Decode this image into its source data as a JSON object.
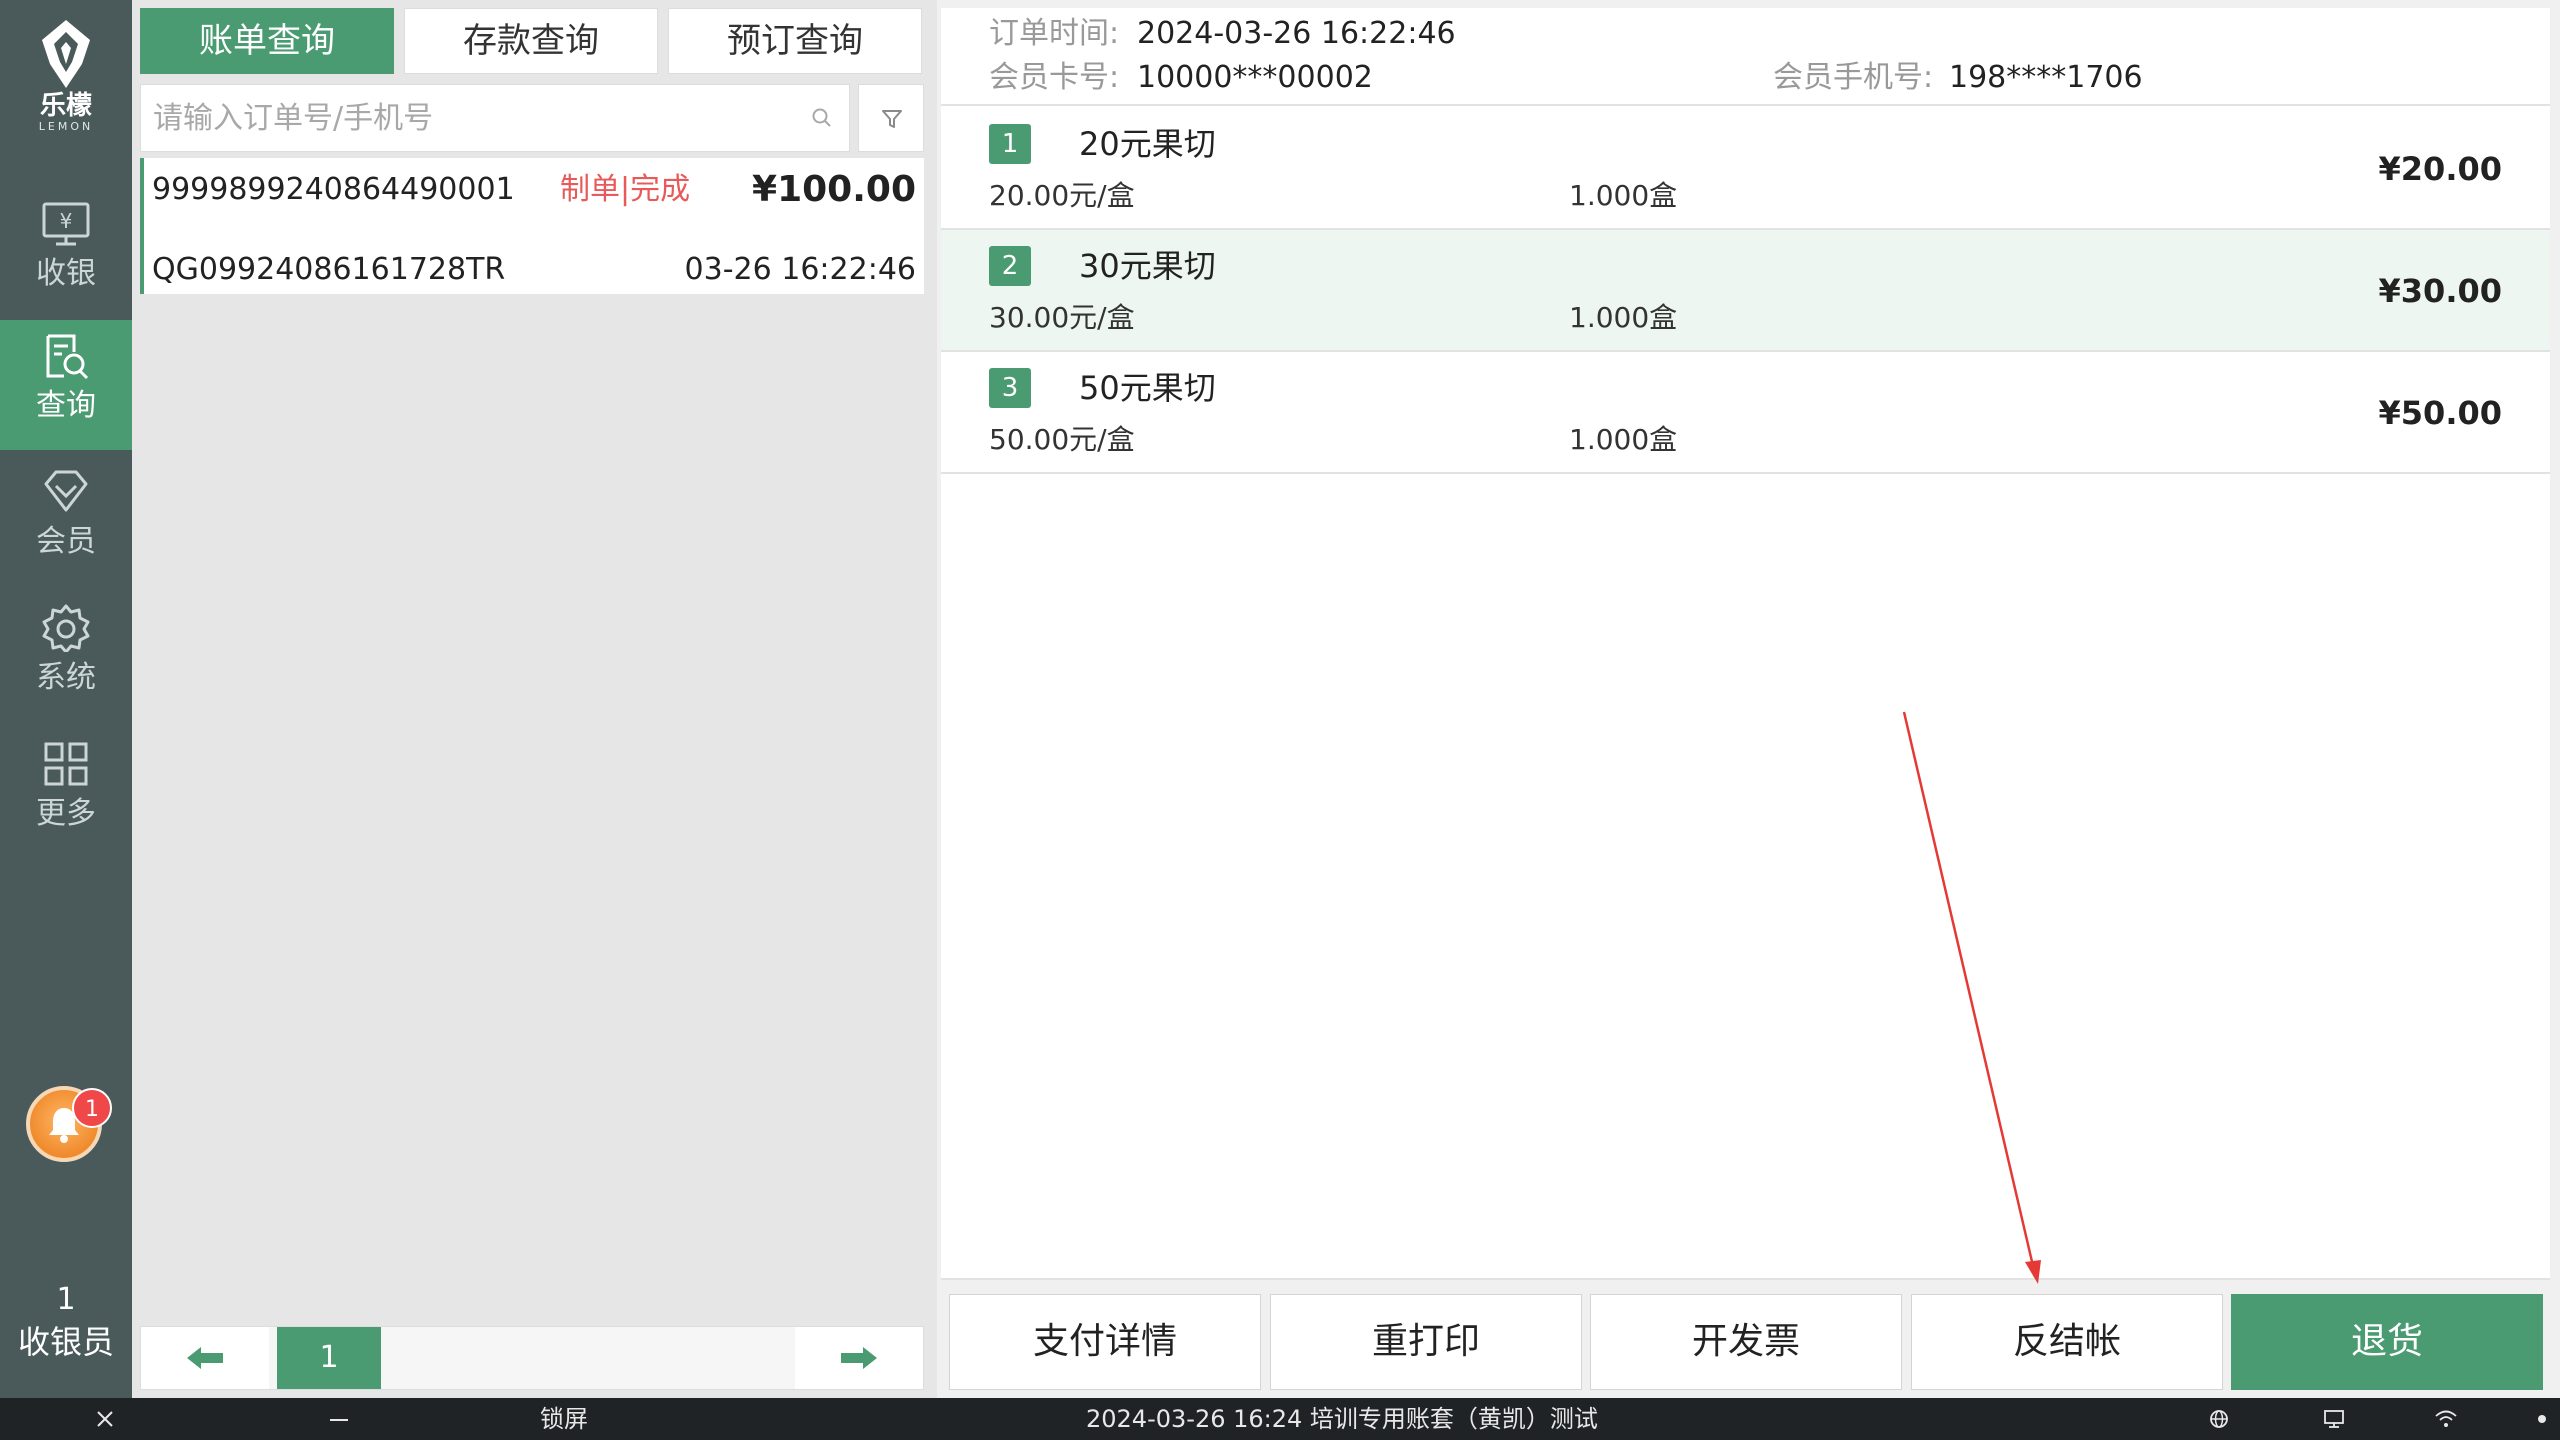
{
  "sidebar": {
    "logo_cn": "乐檬",
    "logo_en": "LEMON",
    "items": [
      {
        "label": "收银",
        "icon": "cashier-icon"
      },
      {
        "label": "查询",
        "icon": "query-icon"
      },
      {
        "label": "会员",
        "icon": "member-icon"
      },
      {
        "label": "系统",
        "icon": "settings-icon"
      },
      {
        "label": "更多",
        "icon": "grid-icon"
      }
    ],
    "notification_count": "1",
    "cashier_number": "1",
    "cashier_label": "收银员"
  },
  "tabs": [
    {
      "label": "账单查询",
      "active": true
    },
    {
      "label": "存款查询",
      "active": false
    },
    {
      "label": "预订查询",
      "active": false
    }
  ],
  "search": {
    "placeholder": "请输入订单号/手机号",
    "value": ""
  },
  "orders": [
    {
      "order_no": "9999899240864490001",
      "status": "制单|完成",
      "amount": "¥100.00",
      "code": "QG09924086161728TR",
      "time": "03-26 16:22:46"
    }
  ],
  "pager": {
    "current_page": "1"
  },
  "detail": {
    "order_time_label": "订单时间:",
    "order_time": "2024-03-26 16:22:46",
    "member_card_label": "会员卡号:",
    "member_card": "10000***00002",
    "member_phone_label": "会员手机号:",
    "member_phone": "198****1706",
    "items": [
      {
        "index": "1",
        "name": "20元果切",
        "unit_price": "20.00元/盒",
        "qty": "1.000盒",
        "price": "¥20.00"
      },
      {
        "index": "2",
        "name": "30元果切",
        "unit_price": "30.00元/盒",
        "qty": "1.000盒",
        "price": "¥30.00"
      },
      {
        "index": "3",
        "name": "50元果切",
        "unit_price": "50.00元/盒",
        "qty": "1.000盒",
        "price": "¥50.00"
      }
    ]
  },
  "actions": {
    "payment_details": "支付详情",
    "reprint": "重打印",
    "invoice": "开发票",
    "reverse_checkout": "反结帐",
    "return_goods": "退货"
  },
  "statusbar": {
    "lock": "锁屏",
    "info": "2024-03-26 16:24 培训专用账套（黄凯）测试"
  },
  "colors": {
    "accent": "#4a9a72",
    "sidebar_bg": "#4a5a5a",
    "status_red": "#e85a5a",
    "annotation_arrow": "#e53935"
  }
}
